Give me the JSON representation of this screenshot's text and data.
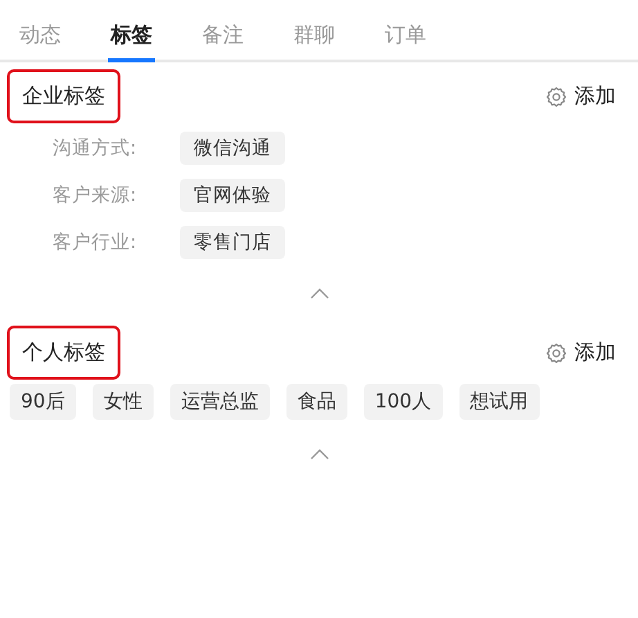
{
  "tabs": [
    {
      "label": "动态",
      "selected": false
    },
    {
      "label": "标签",
      "selected": true
    },
    {
      "label": "备注",
      "selected": false
    },
    {
      "label": "群聊",
      "selected": false
    },
    {
      "label": "订单",
      "selected": false
    }
  ],
  "sections": [
    {
      "kind": "fields",
      "title": "企业标签",
      "highlighted": true,
      "action": "添加",
      "fields": [
        {
          "label": "沟通方式:",
          "value": "微信沟通"
        },
        {
          "label": "客户来源:",
          "value": "官网体验"
        },
        {
          "label": "客户行业:",
          "value": "零售门店"
        }
      ],
      "expanded": true
    },
    {
      "kind": "tags",
      "title": "个人标签",
      "highlighted": true,
      "action": "添加",
      "tags": [
        "90后",
        "女性",
        "运营总监",
        "食品",
        "100人",
        "想试用"
      ],
      "expanded": true
    }
  ]
}
